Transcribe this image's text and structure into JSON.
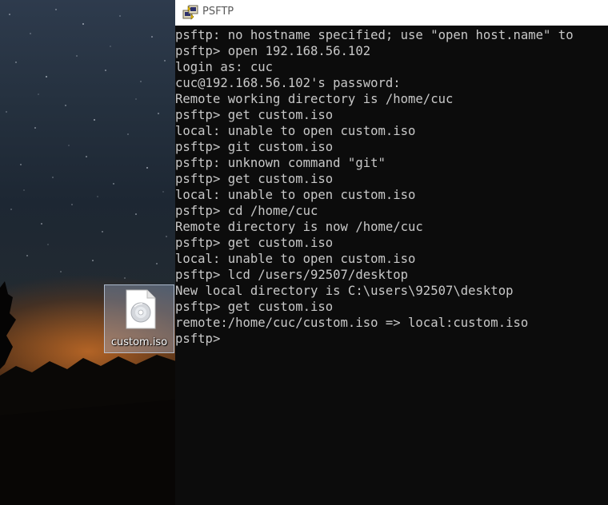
{
  "window": {
    "title": "PSFTP",
    "icon": "putty-psftp-icon"
  },
  "desktop": {
    "file_icon": {
      "label": "custom.iso",
      "icon": "disc-image-file-icon"
    }
  },
  "console": {
    "lines": [
      "psftp: no hostname specified; use \"open host.name\" to",
      "psftp> open 192.168.56.102",
      "login as: cuc",
      "cuc@192.168.56.102's password:",
      "Remote working directory is /home/cuc",
      "psftp> get custom.iso",
      "local: unable to open custom.iso",
      "psftp> git custom.iso",
      "psftp: unknown command \"git\"",
      "psftp> get custom.iso",
      "local: unable to open custom.iso",
      "psftp> cd /home/cuc",
      "Remote directory is now /home/cuc",
      "psftp> get custom.iso",
      "local: unable to open custom.iso",
      "psftp> lcd /users/92507/desktop",
      "New local directory is C:\\users\\92507\\desktop",
      "psftp> get custom.iso",
      "remote:/home/cuc/custom.iso => local:custom.iso",
      "psftp>"
    ],
    "text_color": "#c8c8c8",
    "background": "#0c0c0c"
  }
}
